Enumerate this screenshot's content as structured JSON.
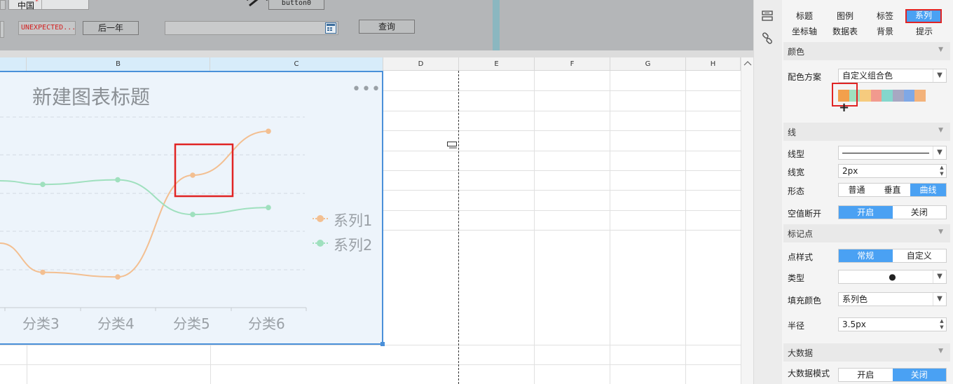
{
  "param_bar": {
    "region_value": "中国",
    "error_text": "UNEXPECTED...",
    "next_year_label": "后一年",
    "date_input_value": "",
    "button0_label": "button0",
    "query_label": "查询"
  },
  "sheet": {
    "columns": [
      "B",
      "C",
      "D",
      "E",
      "F",
      "G",
      "H"
    ]
  },
  "chart": {
    "title": "新建图表标题",
    "more_icon": "more-horizontal-icon",
    "legend": [
      "系列1",
      "系列2"
    ],
    "colors": {
      "series1": "#f3bf91",
      "series2": "#9fe0be"
    }
  },
  "chart_data": {
    "type": "line",
    "title": "新建图表标题",
    "categories": [
      "分类3",
      "分类4",
      "分类5",
      "分类6"
    ],
    "series": [
      {
        "name": "系列1",
        "values": [
          18,
          16,
          60,
          79
        ]
      },
      {
        "name": "系列2",
        "values": [
          56,
          58,
          43,
          46
        ]
      }
    ],
    "grid": true,
    "smooth": true,
    "legend_position": "right"
  },
  "panel": {
    "tabs_row1": [
      "标题",
      "图例",
      "标签",
      "系列"
    ],
    "tabs_row2": [
      "坐标轴",
      "数据表",
      "背景",
      "提示"
    ],
    "active_tab": "系列",
    "color_section": "颜色",
    "color_scheme_label": "配色方案",
    "color_scheme_value": "自定义组合色",
    "palette": [
      "#f3a04c",
      "#9fe0be",
      "#f6cb7e",
      "#f19a8e",
      "#84d6cc",
      "#a7a8c2",
      "#7fa8e6",
      "#f3b27a"
    ],
    "line_section": "线",
    "line_type_label": "线型",
    "line_width_label": "线宽",
    "line_width_value": "2px",
    "shape_label": "形态",
    "shape_options": [
      "普通",
      "垂直",
      "曲线"
    ],
    "null_break_label": "空值断开",
    "null_break_options": [
      "开启",
      "关闭"
    ],
    "marker_section": "标记点",
    "marker_style_label": "点样式",
    "marker_style_options": [
      "常规",
      "自定义"
    ],
    "marker_type_label": "类型",
    "marker_type_value": "●",
    "fill_color_label": "填充颜色",
    "fill_color_value": "系列色",
    "radius_label": "半径",
    "radius_value": "3.5px",
    "bigdata_section": "大数据",
    "bigdata_mode_label": "大数据模式",
    "bigdata_mode_options": [
      "开启",
      "关闭"
    ]
  }
}
